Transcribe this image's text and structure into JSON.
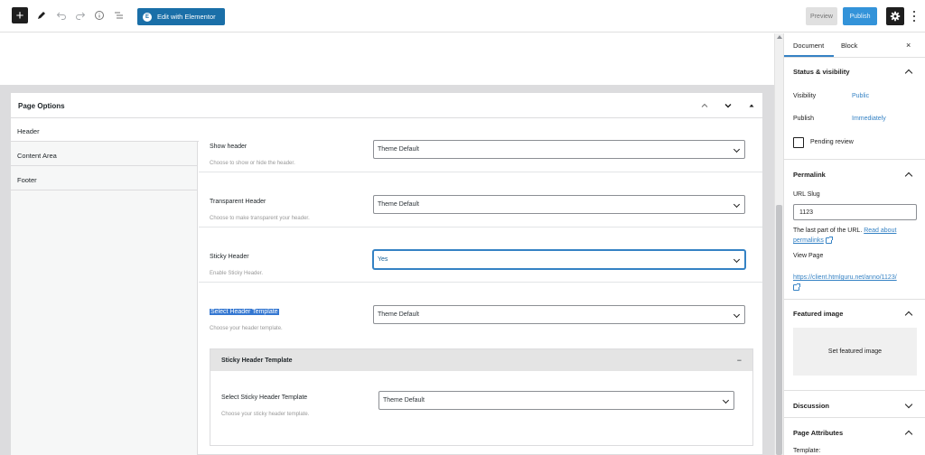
{
  "toolbar": {
    "edit_elementor_label": "Edit with Elementor",
    "elementor_logo_letter": "E",
    "preview_label": "Preview",
    "publish_label": "Publish"
  },
  "page_options": {
    "title": "Page Options",
    "tabs": [
      "Header",
      "Content Area",
      "Footer"
    ],
    "active_tab": "Header",
    "fields": [
      {
        "label": "Show header",
        "description": "Choose to show or hide the header.",
        "value": "Theme Default"
      },
      {
        "label": "Transparent Header",
        "description": "Choose to make transparent your header.",
        "value": "Theme Default"
      },
      {
        "label": "Sticky Header",
        "description": "Enable Sticky Header.",
        "value": "Yes"
      },
      {
        "label": "Select Header Template",
        "description": "Choose your header template.",
        "value": "Theme Default"
      }
    ],
    "sticky_template": {
      "title": "Sticky Header Template",
      "collapse_symbol": "−",
      "field": {
        "label": "Select Sticky Header Template",
        "description": "Choose your sticky header template.",
        "value": "Theme Default"
      }
    }
  },
  "sidebar": {
    "tabs": [
      "Document",
      "Block"
    ],
    "active_tab": "Document",
    "close_symbol": "×",
    "status": {
      "title": "Status & visibility",
      "visibility_label": "Visibility",
      "visibility_value": "Public",
      "publish_label": "Publish",
      "publish_value": "Immediately",
      "pending_label": "Pending review"
    },
    "permalink": {
      "title": "Permalink",
      "slug_label": "URL Slug",
      "slug_value": "1123",
      "help_text": "The last part of the URL.",
      "help_link_1": "Read about",
      "help_link_2": "permalinks",
      "view_page_label": "View Page",
      "view_page_url": "https://client.htmlguru.net/anno/1123/"
    },
    "featured": {
      "title": "Featured image",
      "set_label": "Set featured image"
    },
    "discussion_title": "Discussion",
    "page_attributes": {
      "title": "Page Attributes",
      "template_label": "Template:"
    }
  },
  "colors": {
    "accent": "#3582c4",
    "elementor": "#1a6fa8",
    "publish": "#3393d9"
  }
}
